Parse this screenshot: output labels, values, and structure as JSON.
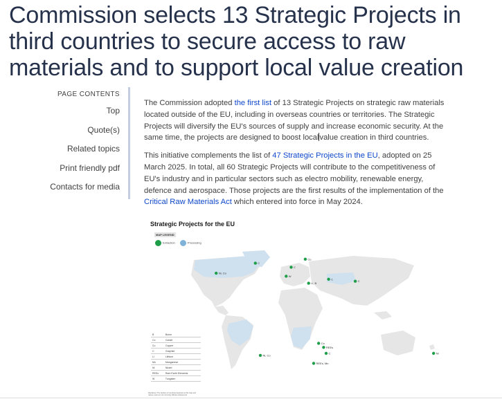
{
  "headline": "Commission selects 13 Strategic Projects in third countries to secure access to raw materials and to support local value creation",
  "toc": {
    "title": "PAGE CONTENTS",
    "items": [
      {
        "label": "Top"
      },
      {
        "label": "Quote(s)"
      },
      {
        "label": "Related topics"
      },
      {
        "label": "Print friendly pdf"
      },
      {
        "label": "Contacts for media"
      }
    ]
  },
  "article": {
    "p1": {
      "t1": "The Commission adopted ",
      "link1": "the first list",
      "t2": " of 13 Strategic Projects on strategic raw materials located outside of the EU, including in overseas countries or territories. The Strategic Projects will diversify the EU's sources of supply and increase economic security. At the same time, the projects are designed to boost local",
      "t3": "value creation in third countries."
    },
    "p2": {
      "t1": "This initiative complements the list of ",
      "link1": "47 Strategic Projects in the EU",
      "t2": ", adopted on 25 March 2025. In total, all 60 Strategic Projects will contribute to the competitiveness of EU's industry and in particular sectors such as electro mobility, renewable energy, defence and aerospace. Those projects are the first results of the implementation of the ",
      "link2": "Critical Raw Materials Act",
      "t3": " which entered into force in May 2024."
    }
  },
  "map": {
    "title": "Strategic Projects for the EU",
    "legend_tag": "MAP LEGEND",
    "legend": [
      {
        "label": "Extraction",
        "color": "#1f9e4a"
      },
      {
        "label": "Processing",
        "color": "#7fb2d6"
      }
    ],
    "colors": {
      "ocean": "#ffffff",
      "land": "#e6e6e6",
      "highlight": "#cfe0ee",
      "marker": "#1f9e4a"
    },
    "markers": [
      {
        "label": "Ni, Co",
        "lon": -95,
        "lat": 58
      },
      {
        "label": "C",
        "lon": -48,
        "lat": 68
      },
      {
        "label": "C",
        "lon": -5,
        "lat": 64
      },
      {
        "label": "Cu",
        "lon": 12,
        "lat": 72
      },
      {
        "label": "W",
        "lon": -11,
        "lat": 55
      },
      {
        "label": "Li, B",
        "lon": 16,
        "lat": 48
      },
      {
        "label": "C",
        "lon": 40,
        "lat": 52
      },
      {
        "label": "C",
        "lon": 72,
        "lat": 50
      },
      {
        "label": "Ni, Co",
        "lon": -42,
        "lat": -24
      },
      {
        "label": "Co",
        "lon": 28,
        "lat": -12
      },
      {
        "label": "REEs",
        "lon": 34,
        "lat": -16
      },
      {
        "label": "C",
        "lon": 37,
        "lat": -22
      },
      {
        "label": "REEs, Mn",
        "lon": 22,
        "lat": -32
      },
      {
        "label": "Ni",
        "lon": 166,
        "lat": -22
      }
    ],
    "abbreviations": [
      {
        "code": "B",
        "name": "Boron"
      },
      {
        "code": "Co",
        "name": "Cobalt"
      },
      {
        "code": "Cu",
        "name": "Copper"
      },
      {
        "code": "C",
        "name": "Graphite"
      },
      {
        "code": "Li",
        "name": "Lithium"
      },
      {
        "code": "Mn",
        "name": "Manganese"
      },
      {
        "code": "Ni",
        "name": "Nickel"
      },
      {
        "code": "REEs",
        "name": "Rare Earth Elements"
      },
      {
        "code": "W",
        "name": "Tungsten"
      }
    ],
    "disclaimer": "Disclaimer: The borders of countries depicted on this map and names used on it do not imply official endorsement"
  }
}
